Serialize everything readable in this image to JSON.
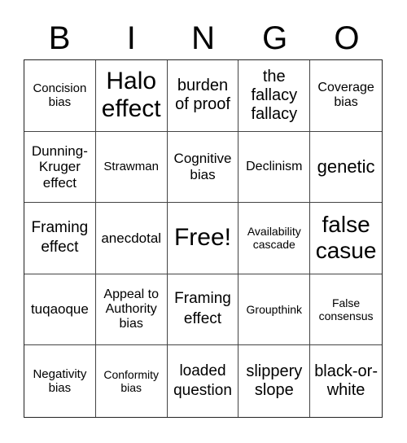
{
  "header": {
    "letters": [
      "B",
      "I",
      "N",
      "G",
      "O"
    ]
  },
  "cells": [
    "Concision bias",
    "Halo effect",
    "burden of proof",
    "the fallacy fallacy",
    "Coverage bias",
    "Dunning-Kruger effect",
    "Strawman",
    "Cognitive bias",
    "Declinism",
    "genetic",
    "Framing effect",
    "anecdotal",
    "Free!",
    "Availability cascade",
    "false casue",
    "tuqaoque",
    "Appeal to Authority bias",
    "Framing effect",
    "Groupthink",
    "False consensus",
    "Negativity bias",
    "Conformity bias",
    "loaded question",
    "slippery slope",
    "black-or-white"
  ]
}
